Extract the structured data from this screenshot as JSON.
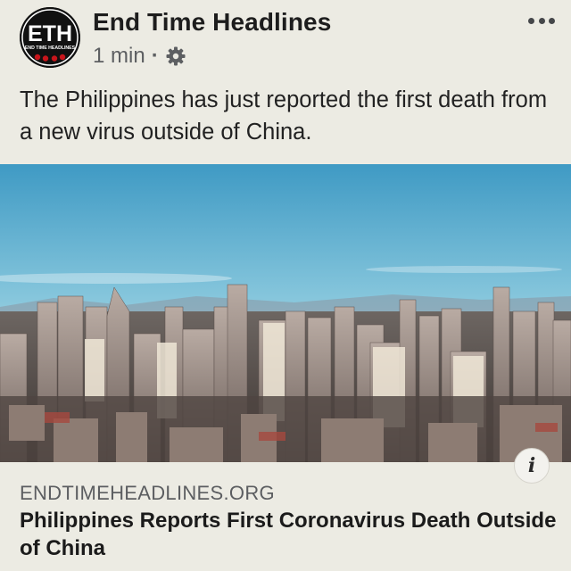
{
  "post": {
    "author": "End Time Headlines",
    "avatar_text": "ETH",
    "avatar_subtext": "END TIME HEADLINES",
    "time": "1 min",
    "separator": "·",
    "audience_icon": "globe-gear-icon",
    "more_icon": "more-options-icon",
    "text": "The Philippines has just reported the first death from a new virus outside of China."
  },
  "photo": {
    "subject": "city-skyline-photo",
    "info_icon": "info-icon",
    "info_glyph": "i"
  },
  "link_preview": {
    "domain": "ENDTIMEHEADLINES.ORG",
    "title": "Philippines Reports First Coronavirus Death Outside of China"
  },
  "colors": {
    "background": "#ecebe3",
    "text": "#1c1e21",
    "secondary_text": "#5d5f62",
    "avatar_bg": "#111111",
    "avatar_accent": "#c8151b"
  }
}
